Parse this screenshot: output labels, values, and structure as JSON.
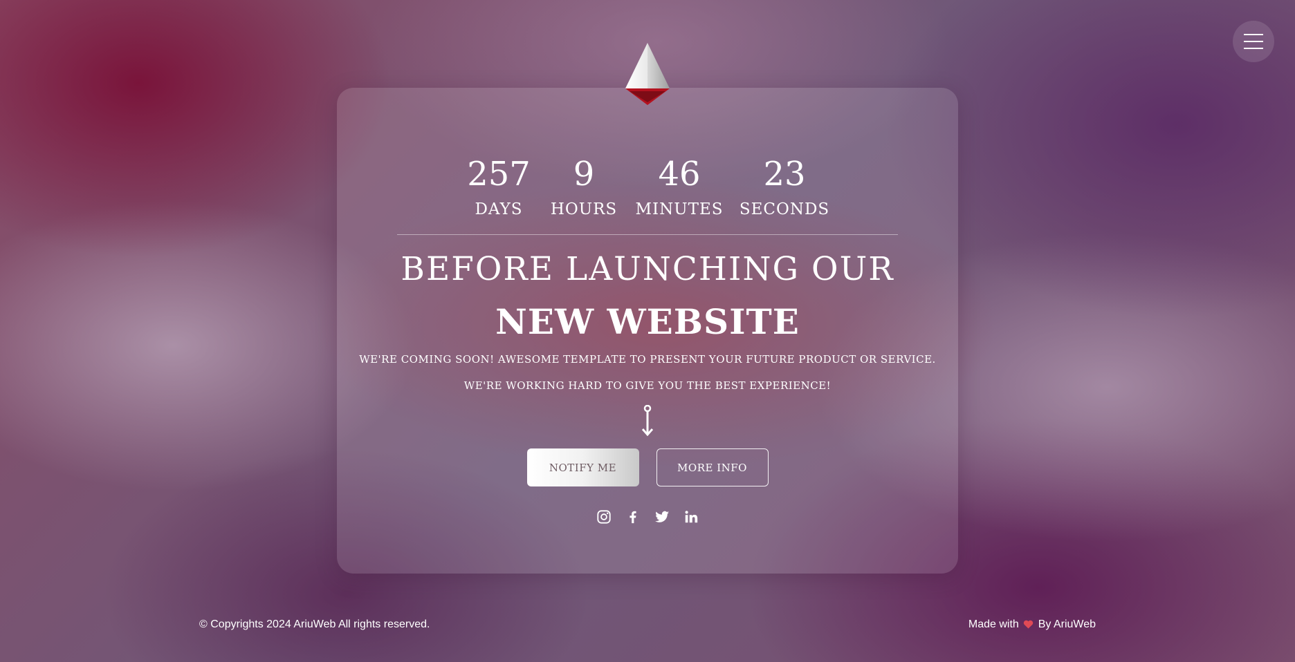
{
  "countdown": {
    "days": {
      "value": "257",
      "label": "DAYS"
    },
    "hours": {
      "value": "9",
      "label": "HOURS"
    },
    "minutes": {
      "value": "46",
      "label": "MINUTES"
    },
    "seconds": {
      "value": "23",
      "label": "SECONDS"
    }
  },
  "headline": {
    "line1": "BEFORE LAUNCHING OUR",
    "line2": "NEW WEBSITE"
  },
  "taglines": [
    "WE'RE COMING SOON! AWESOME TEMPLATE TO PRESENT YOUR FUTURE PRODUCT OR SERVICE.",
    "WE'RE WORKING HARD TO GIVE YOU THE BEST EXPERIENCE!"
  ],
  "buttons": {
    "notify": "NOTIFY ME",
    "more_info": "MORE INFO"
  },
  "social": [
    "instagram-icon",
    "facebook-icon",
    "twitter-icon",
    "linkedin-icon"
  ],
  "footer": {
    "copyright": "© Copyrights 2024 AriuWeb All rights reserved.",
    "made_with_prefix": "Made with",
    "made_with_suffix": "By AriuWeb"
  },
  "colors": {
    "logo_accent": "#b3121f",
    "heart": "#e04a55",
    "notify_text": "#6e5c63"
  },
  "icons": {
    "menu": "hamburger-menu-icon",
    "logo": "pyramid-logo-icon",
    "scroll": "scroll-down-arrow-icon",
    "heart": "heart-icon"
  }
}
